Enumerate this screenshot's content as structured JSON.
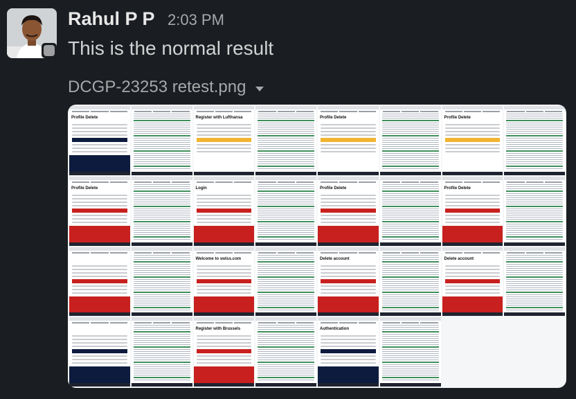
{
  "message": {
    "sender": "Rahul P P",
    "time": "2:03 PM",
    "text": "This is the normal result",
    "attachment": {
      "filename": "DCGP-23253 retest.png",
      "icon": "chevron-down-icon"
    }
  },
  "avatar": {
    "status": "away"
  },
  "screenshot_tiles": [
    {
      "title": "Profile Delete",
      "theme": "dark"
    },
    {
      "title": "",
      "theme": "sheet"
    },
    {
      "title": "Register with Lufthansa",
      "theme": "orange"
    },
    {
      "title": "",
      "theme": "sheet"
    },
    {
      "title": "Profile Delete",
      "theme": "orange"
    },
    {
      "title": "",
      "theme": "sheet"
    },
    {
      "title": "Profile Delete",
      "theme": "orange"
    },
    {
      "title": "",
      "theme": "sheet"
    },
    {
      "title": "Profile Delete",
      "theme": "red"
    },
    {
      "title": "",
      "theme": "sheet"
    },
    {
      "title": "Login",
      "theme": "red"
    },
    {
      "title": "",
      "theme": "sheet"
    },
    {
      "title": "Profile Delete",
      "theme": "red"
    },
    {
      "title": "",
      "theme": "sheet"
    },
    {
      "title": "Profile Delete",
      "theme": "red"
    },
    {
      "title": "",
      "theme": "sheet"
    },
    {
      "title": "",
      "theme": "red"
    },
    {
      "title": "",
      "theme": "sheet"
    },
    {
      "title": "Welcome to swiss.com",
      "theme": "red"
    },
    {
      "title": "",
      "theme": "sheet"
    },
    {
      "title": "Delete account",
      "theme": "red"
    },
    {
      "title": "",
      "theme": "sheet"
    },
    {
      "title": "Delete account",
      "theme": "red"
    },
    {
      "title": "",
      "theme": "sheet"
    },
    {
      "title": "",
      "theme": "dark"
    },
    {
      "title": "",
      "theme": "sheet"
    },
    {
      "title": "Register with Brussels",
      "theme": "red"
    },
    {
      "title": "",
      "theme": "sheet"
    },
    {
      "title": "Authentication",
      "theme": "dark"
    },
    {
      "title": "",
      "theme": "sheet"
    }
  ]
}
